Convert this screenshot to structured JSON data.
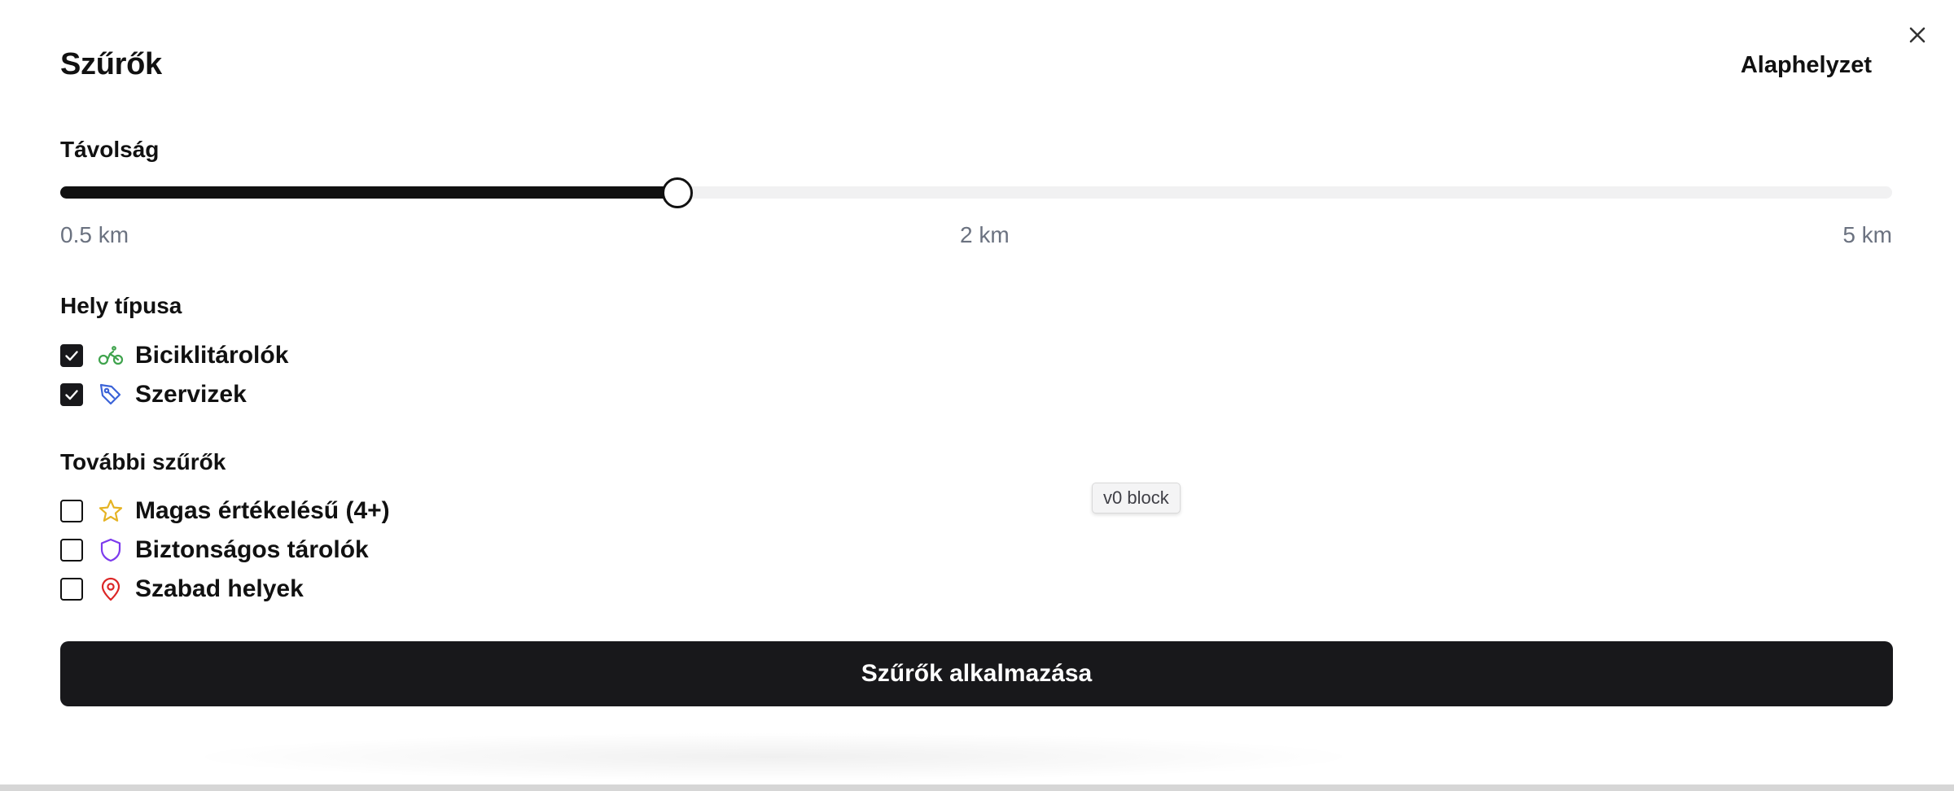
{
  "dialog": {
    "title": "Szűrők",
    "reset_label": "Alaphelyzet",
    "close_icon": "close-icon"
  },
  "distance": {
    "label": "Távolság",
    "value_fraction": 0.337,
    "ticks": [
      "0.5 km",
      "2 km",
      "5 km"
    ],
    "fill_color": "#111111",
    "track_color": "#f1f1f2"
  },
  "place_type": {
    "label": "Hely típusa",
    "options": [
      {
        "label": "Biciklitárolók",
        "checked": true,
        "icon": "bike-icon",
        "icon_color": "#3fa34d"
      },
      {
        "label": "Szervizek",
        "checked": true,
        "icon": "wrench-tag-icon",
        "icon_color": "#3b63d8"
      }
    ]
  },
  "more_filters": {
    "label": "További szűrők",
    "options": [
      {
        "label": "Magas értékelésű (4+)",
        "checked": false,
        "icon": "star-icon",
        "icon_color": "#e5b323"
      },
      {
        "label": "Biztonságos tárolók",
        "checked": false,
        "icon": "shield-icon",
        "icon_color": "#7c3aed"
      },
      {
        "label": "Szabad helyek",
        "checked": false,
        "icon": "map-pin-icon",
        "icon_color": "#dc2626"
      }
    ]
  },
  "badge": {
    "text": "v0 block"
  },
  "apply": {
    "label": "Szűrők alkalmazása",
    "background": "#18181b"
  }
}
